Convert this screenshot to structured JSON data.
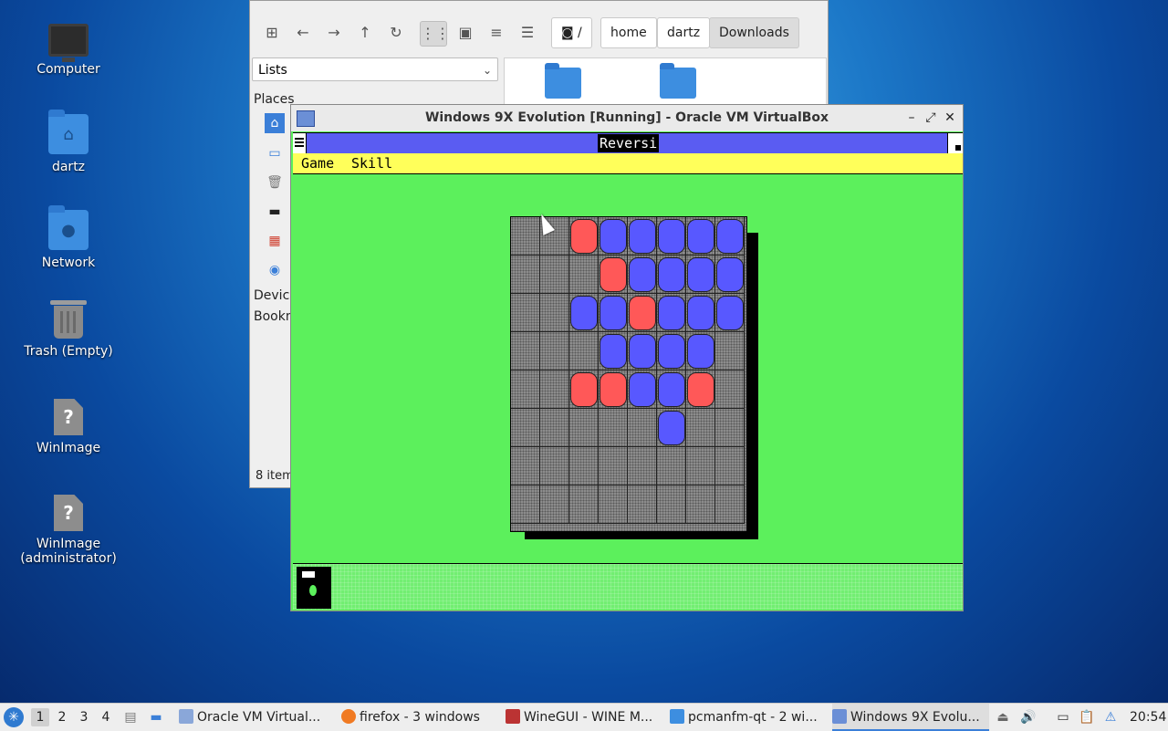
{
  "desktop": {
    "icons": [
      {
        "label": "Computer",
        "icon": "computer-icon"
      },
      {
        "label": "dartz",
        "icon": "home-folder-icon"
      },
      {
        "label": "Network",
        "icon": "network-folder-icon"
      },
      {
        "label": "Trash (Empty)",
        "icon": "trash-icon"
      },
      {
        "label": "WinImage",
        "icon": "unknown-file-icon"
      },
      {
        "label": "WinImage\n(administrator)",
        "icon": "unknown-file-icon"
      }
    ]
  },
  "file_manager": {
    "view_select": "Lists",
    "breadcrumbs": [
      "/",
      "home",
      "dartz",
      "Downloads"
    ],
    "side_labels": {
      "places": "Places",
      "devices": "Device",
      "bookmarks": "Bookn"
    },
    "status": "8 item"
  },
  "vbox": {
    "title": "Windows 9X Evolution [Running] - Oracle VM VirtualBox",
    "minimize": "–",
    "restore": "⤢",
    "close": "✕"
  },
  "reversi": {
    "title": "Reversi",
    "menu": [
      "Game",
      "Skill"
    ],
    "colors": {
      "red": "#ff5858",
      "blue": "#5858ff",
      "board_bg": "#5cf05c"
    },
    "board": [
      "..RBBBBB",
      "...RBBBB",
      "..BBRBBB",
      "...BBBB.",
      "..RRBBR.",
      ".....B..",
      "........",
      "........"
    ]
  },
  "taskbar": {
    "workspaces": [
      "1",
      "2",
      "3",
      "4"
    ],
    "active_workspace": "1",
    "tasks": [
      {
        "label": "Oracle VM Virtual...",
        "icon": "virtualbox-icon"
      },
      {
        "label": "firefox - 3 windows",
        "icon": "firefox-icon"
      },
      {
        "label": "WineGUI - WINE M...",
        "icon": "wine-icon"
      },
      {
        "label": "pcmanfm-qt - 2 wi...",
        "icon": "folder-icon"
      },
      {
        "label": "Windows 9X Evolu...",
        "icon": "virtualbox-icon"
      }
    ],
    "clock": "20:54"
  }
}
